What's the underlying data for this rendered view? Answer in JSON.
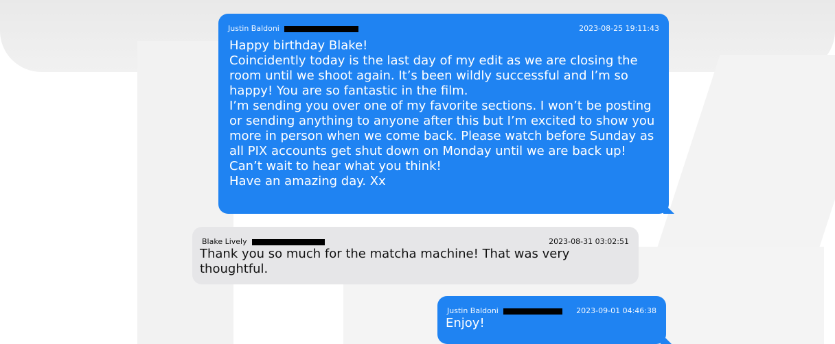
{
  "messages": [
    {
      "sender": "Justin Baldoni",
      "timestamp": "2023-08-25 19:11:43",
      "text": "Happy birthday Blake!\nCoincidently today is the last day of my edit as we are closing the room until we shoot again. It’s been wildly successful and I’m so happy! You are so fantastic in the film.\nI’m sending you over one of my favorite sections. I won’t be posting or sending anything to anyone after this but I’m excited to show you more in person when we come back. Please watch before Sunday as all PIX accounts get shut down on Monday until we are back up! Can’t wait to hear what you think!\nHave an amazing day. Xx"
    },
    {
      "sender": "Blake Lively",
      "timestamp": "2023-08-31 03:02:51",
      "text": "Thank you so much for the matcha machine! That was very thoughtful."
    },
    {
      "sender": "Justin Baldoni",
      "timestamp": "2023-09-01 04:46:38",
      "text": "Enjoy!"
    }
  ],
  "colors": {
    "sent_bubble": "#1f83f2",
    "received_bubble": "#e6e6e8",
    "redaction": "#000000"
  }
}
